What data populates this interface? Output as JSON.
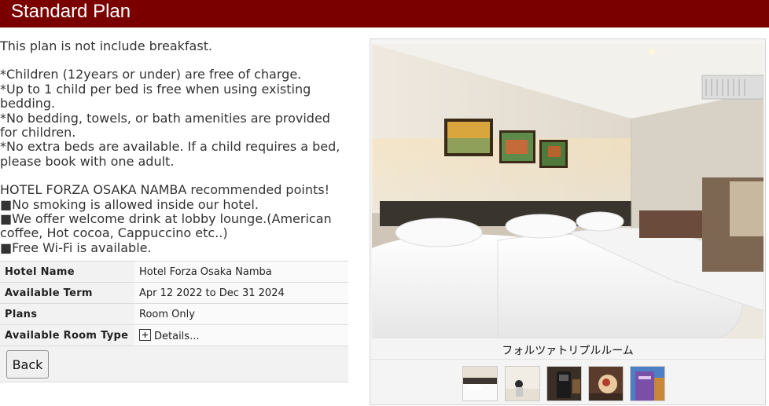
{
  "header": {
    "title": "Standard Plan"
  },
  "description": {
    "line1": "This plan is not include breakfast.",
    "notes": [
      "*Children (12years or under) are free of charge.",
      "*Up to 1 child per bed is free when using existing bedding.",
      "*No bedding, towels, or bath amenities are provided for children.",
      "*No extra beds are available. If a child requires a bed, please book with one adult."
    ],
    "points_title": "HOTEL FORZA OSAKA NAMBA recommended points!",
    "points": [
      "■No smoking is allowed inside our hotel.",
      "■We offer welcome drink at lobby lounge.(American coffee, Hot cocoa, Cappuccino etc..)",
      "■Free Wi-Fi is available."
    ]
  },
  "info": {
    "hotel_name_label": "Hotel Name",
    "hotel_name": "Hotel Forza Osaka Namba",
    "term_label": "Available Term",
    "term": "Apr 12 2022 to Dec 31 2024",
    "plans_label": "Plans",
    "plans": "Room Only",
    "room_type_label": "Available Room Type",
    "room_type_link": "Details..."
  },
  "back_button": "Back",
  "gallery": {
    "caption": "フォルツァトリプルルーム",
    "thumbs": [
      "thumb-room",
      "thumb-lounge",
      "thumb-drink-machine",
      "thumb-food",
      "thumb-exterior"
    ]
  }
}
